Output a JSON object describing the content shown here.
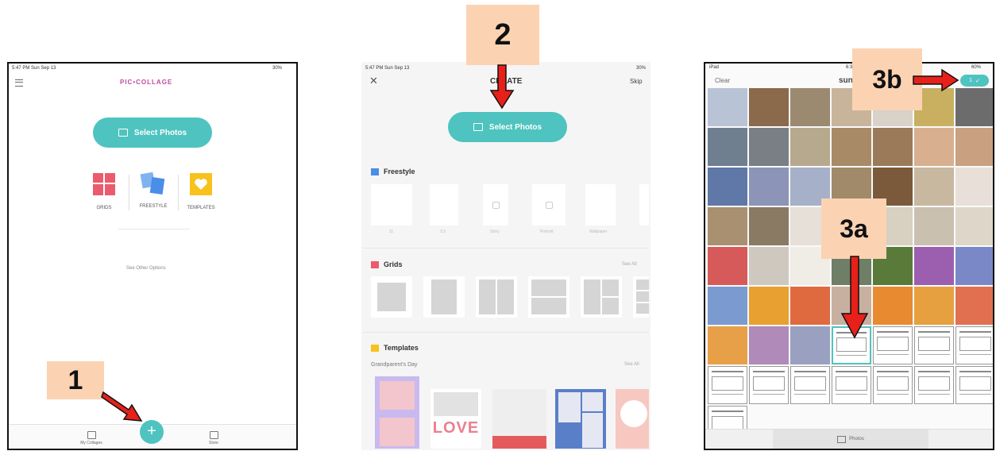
{
  "screen1": {
    "status_left": "5:47 PM   Sun Sep 13",
    "status_right": "30%",
    "app_title": "PIC•COLLAGE",
    "select_photos": "Select Photos",
    "options": [
      "GRIDS",
      "FREESTYLE",
      "TEMPLATES"
    ],
    "see_other": "See Other Options",
    "tabs": [
      "My Collages",
      "Store"
    ],
    "callout": "1"
  },
  "screen2": {
    "status_left": "5:47 PM   Sun Sep 13",
    "status_right": "30%",
    "title": "CREATE",
    "skip": "Skip",
    "select_photos": "Select Photos",
    "freestyle": "Freestyle",
    "freestyle_items": [
      "11",
      "2:3",
      "Story",
      "Portrait",
      "Wallpaper"
    ],
    "grids": "Grids",
    "see_all": "See All",
    "templates": "Templates",
    "template_sub": "Grandparent's Day",
    "love": "LOVE",
    "callout": "2"
  },
  "screen3": {
    "status_left": "iPad",
    "status_center": "6:3",
    "status_right": "60%",
    "clear": "Clear",
    "title": "sun",
    "count": "1",
    "tab": "Photos",
    "worksheet_title": "Light Box Experiment",
    "callout_a": "3a",
    "callout_b": "3b"
  },
  "colors": {
    "teal": "#4fc3bf",
    "peach": "#fbd3b3",
    "red": "#e8201a"
  }
}
